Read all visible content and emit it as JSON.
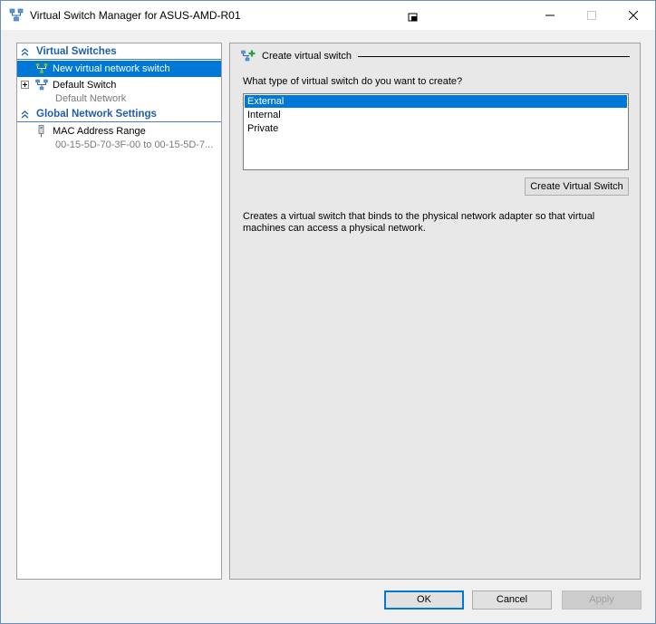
{
  "window": {
    "title": "Virtual Switch Manager for ASUS-AMD-R01"
  },
  "tree": {
    "virtual_switches_header": "Virtual Switches",
    "new_switch_label": "New virtual network switch",
    "default_switch_label": "Default Switch",
    "default_switch_sub": "Default Network",
    "global_settings_header": "Global Network Settings",
    "mac_range_label": "MAC Address Range",
    "mac_range_sub": "00-15-5D-70-3F-00 to 00-15-5D-7..."
  },
  "details": {
    "group_title": "Create virtual switch",
    "question": "What type of virtual switch do you want to create?",
    "switch_types": [
      "External",
      "Internal",
      "Private"
    ],
    "selected_type": "External",
    "create_button": "Create Virtual Switch",
    "description": "Creates a virtual switch that binds to the physical network adapter so that virtual machines can access a physical network."
  },
  "buttons": {
    "ok": "OK",
    "cancel": "Cancel",
    "apply": "Apply"
  },
  "colors": {
    "selection": "#0078d7",
    "header_text": "#1f5fa8"
  }
}
